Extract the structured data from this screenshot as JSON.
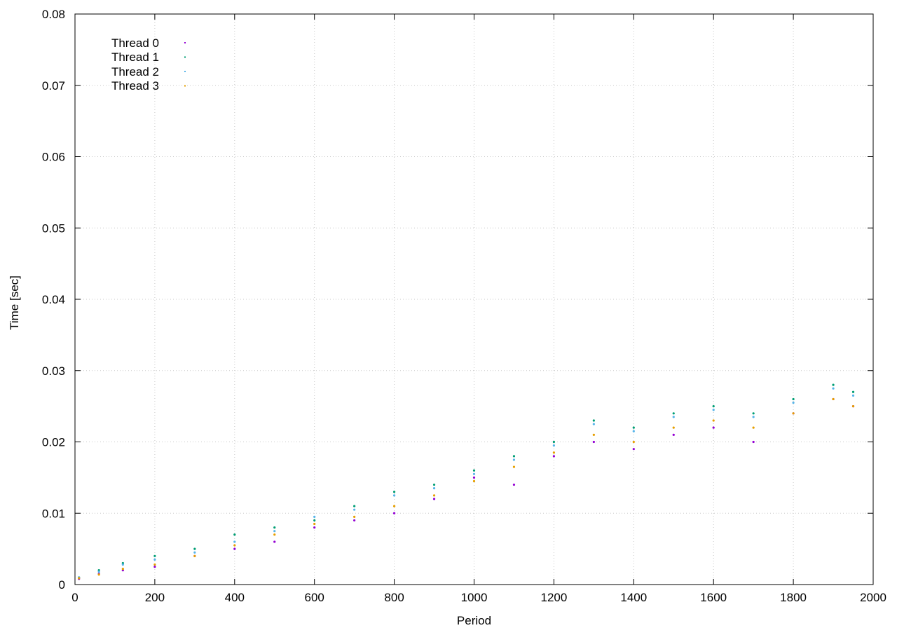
{
  "chart_data": {
    "type": "scatter",
    "xlabel": "Period",
    "ylabel": "Time [sec]",
    "xlim": [
      0,
      2000
    ],
    "ylim": [
      0,
      0.08
    ],
    "x_ticks": [
      "0",
      "200",
      "400",
      "600",
      "800",
      "1000",
      "1200",
      "1400",
      "1600",
      "1800",
      "2000"
    ],
    "y_ticks": [
      "0",
      "0.01",
      "0.02",
      "0.03",
      "0.04",
      "0.05",
      "0.06",
      "0.07",
      "0.08"
    ],
    "grid": true,
    "legend_position": "top-left",
    "series": [
      {
        "name": "Thread 0",
        "color": "#9400d3",
        "values": [
          [
            10,
            0.0008
          ],
          [
            60,
            0.0015
          ],
          [
            120,
            0.002
          ],
          [
            200,
            0.0025
          ],
          [
            300,
            0.004
          ],
          [
            400,
            0.005
          ],
          [
            500,
            0.006
          ],
          [
            600,
            0.008
          ],
          [
            700,
            0.009
          ],
          [
            800,
            0.01
          ],
          [
            900,
            0.012
          ],
          [
            1000,
            0.015
          ],
          [
            1100,
            0.014
          ],
          [
            1200,
            0.018
          ],
          [
            1300,
            0.02
          ],
          [
            1400,
            0.019
          ],
          [
            1500,
            0.021
          ],
          [
            1600,
            0.022
          ],
          [
            1700,
            0.02
          ],
          [
            1800,
            0.024
          ],
          [
            1900,
            0.026
          ],
          [
            1950,
            0.025
          ]
        ]
      },
      {
        "name": "Thread 1",
        "color": "#009e73",
        "values": [
          [
            10,
            0.001
          ],
          [
            60,
            0.002
          ],
          [
            120,
            0.003
          ],
          [
            200,
            0.004
          ],
          [
            300,
            0.005
          ],
          [
            400,
            0.007
          ],
          [
            500,
            0.008
          ],
          [
            600,
            0.009
          ],
          [
            700,
            0.011
          ],
          [
            800,
            0.013
          ],
          [
            900,
            0.014
          ],
          [
            1000,
            0.016
          ],
          [
            1100,
            0.018
          ],
          [
            1200,
            0.02
          ],
          [
            1300,
            0.023
          ],
          [
            1400,
            0.022
          ],
          [
            1500,
            0.024
          ],
          [
            1600,
            0.025
          ],
          [
            1700,
            0.024
          ],
          [
            1800,
            0.026
          ],
          [
            1900,
            0.028
          ],
          [
            1950,
            0.027
          ]
        ]
      },
      {
        "name": "Thread 2",
        "color": "#56b4e9",
        "values": [
          [
            10,
            0.001
          ],
          [
            60,
            0.0018
          ],
          [
            120,
            0.0028
          ],
          [
            200,
            0.0035
          ],
          [
            300,
            0.0045
          ],
          [
            400,
            0.006
          ],
          [
            500,
            0.0075
          ],
          [
            600,
            0.0095
          ],
          [
            700,
            0.0105
          ],
          [
            800,
            0.0125
          ],
          [
            900,
            0.0135
          ],
          [
            1000,
            0.0155
          ],
          [
            1100,
            0.0175
          ],
          [
            1200,
            0.0195
          ],
          [
            1300,
            0.0225
          ],
          [
            1400,
            0.0215
          ],
          [
            1500,
            0.0235
          ],
          [
            1600,
            0.0245
          ],
          [
            1700,
            0.0235
          ],
          [
            1800,
            0.0255
          ],
          [
            1900,
            0.0275
          ],
          [
            1950,
            0.0265
          ]
        ]
      },
      {
        "name": "Thread 3",
        "color": "#e69f00",
        "values": [
          [
            10,
            0.0009
          ],
          [
            60,
            0.0014
          ],
          [
            120,
            0.0022
          ],
          [
            200,
            0.0028
          ],
          [
            300,
            0.004
          ],
          [
            400,
            0.0055
          ],
          [
            500,
            0.007
          ],
          [
            600,
            0.0085
          ],
          [
            700,
            0.0095
          ],
          [
            800,
            0.011
          ],
          [
            900,
            0.0125
          ],
          [
            1000,
            0.0145
          ],
          [
            1100,
            0.0165
          ],
          [
            1200,
            0.0185
          ],
          [
            1300,
            0.021
          ],
          [
            1400,
            0.02
          ],
          [
            1500,
            0.022
          ],
          [
            1600,
            0.023
          ],
          [
            1700,
            0.022
          ],
          [
            1800,
            0.024
          ],
          [
            1900,
            0.026
          ],
          [
            1950,
            0.025
          ]
        ]
      }
    ]
  }
}
